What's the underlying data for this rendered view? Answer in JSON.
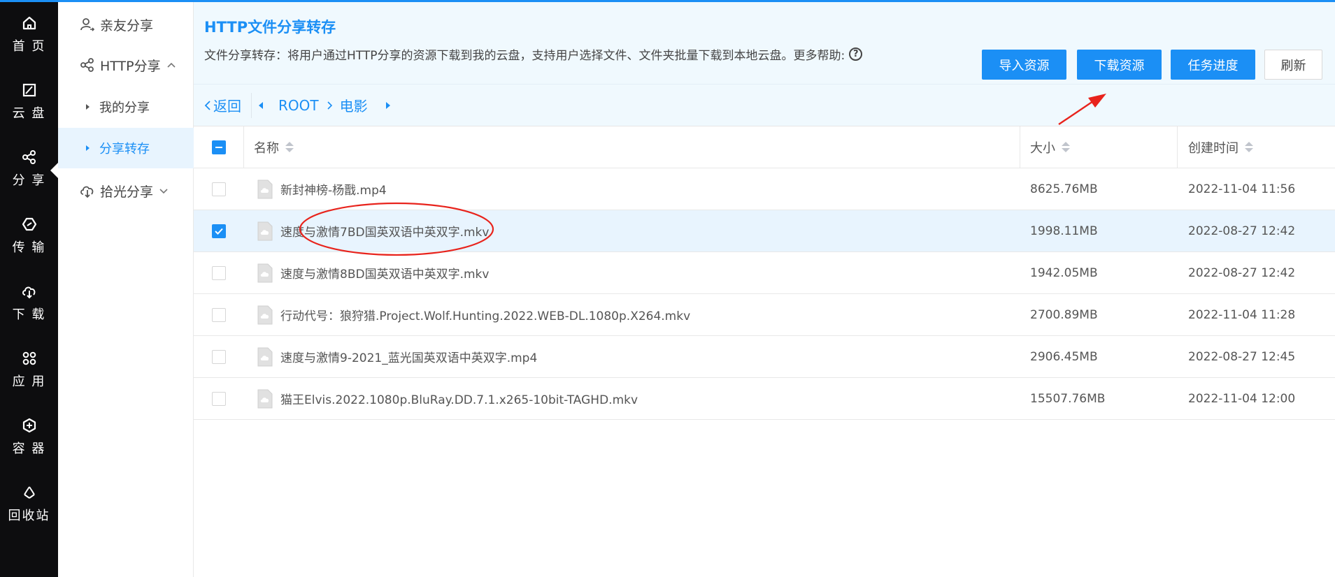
{
  "rail": {
    "items": [
      {
        "label": "首 页",
        "icon": "home-icon"
      },
      {
        "label": "云 盘",
        "icon": "cloud-disk-icon"
      },
      {
        "label": "分 享",
        "icon": "share-icon"
      },
      {
        "label": "传 输",
        "icon": "transfer-icon"
      },
      {
        "label": "下 载",
        "icon": "download-icon"
      },
      {
        "label": "应 用",
        "icon": "apps-icon"
      },
      {
        "label": "容 器",
        "icon": "container-icon"
      },
      {
        "label": "回收站",
        "icon": "recycle-icon"
      }
    ]
  },
  "sidebar": {
    "friends": "亲友分享",
    "http": "HTTP分享",
    "my_share": "我的分享",
    "share_transfer": "分享转存",
    "shiguang": "拾光分享"
  },
  "header": {
    "title": "HTTP文件分享转存",
    "description": "文件分享转存：将用户通过HTTP分享的资源下载到我的云盘，支持用户选择文件、文件夹批量下载到本地云盘。更多帮助:",
    "help": "?",
    "buttons": {
      "import": "导入资源",
      "download": "下载资源",
      "progress": "任务进度",
      "refresh": "刷新"
    }
  },
  "breadcrumb": {
    "back": "返回",
    "root": "ROOT",
    "folder": "电影"
  },
  "table": {
    "columns": {
      "name": "名称",
      "size": "大小",
      "time": "创建时间"
    },
    "rows": [
      {
        "name": "新封神榜-杨戬.mp4",
        "size": "8625.76MB",
        "time": "2022-11-04 11:56",
        "checked": false
      },
      {
        "name": "速度与激情7BD国英双语中英双字.mkv",
        "size": "1998.11MB",
        "time": "2022-08-27 12:42",
        "checked": true
      },
      {
        "name": "速度与激情8BD国英双语中英双字.mkv",
        "size": "1942.05MB",
        "time": "2022-08-27 12:42",
        "checked": false
      },
      {
        "name": "行动代号：狼狩猎.Project.Wolf.Hunting.2022.WEB-DL.1080p.X264.mkv",
        "size": "2700.89MB",
        "time": "2022-11-04 11:28",
        "checked": false
      },
      {
        "name": "速度与激情9-2021_蓝光国英双语中英双字.mp4",
        "size": "2906.45MB",
        "time": "2022-08-27 12:45",
        "checked": false
      },
      {
        "name": "猫王Elvis.2022.1080p.BluRay.DD.7.1.x265-10bit-TAGHD.mkv",
        "size": "15507.76MB",
        "time": "2022-11-04 12:00",
        "checked": false
      }
    ]
  },
  "colors": {
    "accent": "#1b8ff5",
    "rail_bg": "#0d0d0f",
    "header_bg": "#f0f9fe",
    "selected_row": "#e8f4fe",
    "annotation": "#e8231c"
  }
}
